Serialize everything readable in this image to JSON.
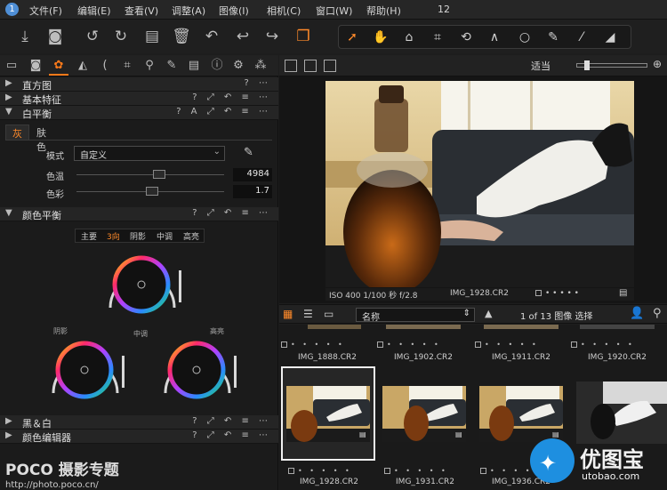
{
  "menu": {
    "items": [
      "文件(F)",
      "编辑(E)",
      "查看(V)",
      "调整(A)",
      "图像(I)",
      "相机(C)",
      "窗口(W)",
      "帮助(H)"
    ],
    "count": "12"
  },
  "toolbar": {
    "icons": [
      "import-icon",
      "camera-icon",
      "undo-circle-icon",
      "redo-circle-icon",
      "export-icon",
      "trash-icon",
      "undo-icon",
      "back-icon",
      "forward-icon",
      "layers-icon"
    ],
    "cursor_tools": [
      "select-cursor-icon",
      "pan-hand-icon",
      "loupe-icon",
      "crop-icon",
      "rotate-icon",
      "keystone-icon",
      "circle-spot-icon",
      "brush-icon",
      "picker-icon",
      "eraser-icon"
    ]
  },
  "left": {
    "sections": {
      "histogram": "直方图",
      "basic": "基本特征",
      "white_balance": "白平衡",
      "color_balance": "颜色平衡",
      "bw": "黑＆白",
      "color_editor": "颜色编辑器"
    },
    "wb_tabs": [
      "灰",
      "肤色"
    ],
    "mode_label": "模式",
    "mode_value": "自定义",
    "temp_label": "色温",
    "temp_value": "4984",
    "tint_label": "色彩",
    "tint_value": "1.7",
    "temp_level": 0.56,
    "tint_level": 0.51,
    "cb_tabs": [
      "主要",
      "3向",
      "阴影",
      "中调",
      "高亮"
    ],
    "wheel_labels": {
      "shadow": "阴影",
      "mid": "中调",
      "high": "高亮"
    }
  },
  "viewer": {
    "fit_label": "适当",
    "info_iso": "ISO 400 1/100 秒 f/2.8",
    "info_name": "IMG_1928.CR2"
  },
  "browser": {
    "sort_label": "名称",
    "count_label": "1 of 13 图像 选择",
    "row1": [
      "IMG_1888.CR2",
      "IMG_1902.CR2",
      "IMG_1911.CR2",
      "IMG_1920.CR2"
    ],
    "row2": [
      "IMG_1928.CR2",
      "IMG_1931.CR2",
      "IMG_1936.CR2"
    ]
  },
  "watermark": {
    "brand": "POCO 摄影专题",
    "url": "http://photo.poco.cn/",
    "logo_text": "优图宝",
    "logo_url": "utobao.com"
  },
  "colors": {
    "accent": "#ff8a2a",
    "bg": "#1d1d1d"
  }
}
